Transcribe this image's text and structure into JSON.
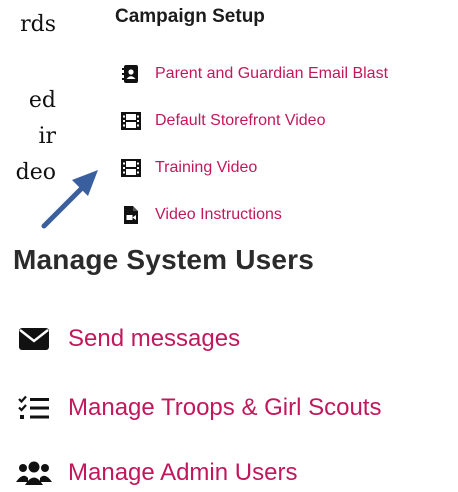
{
  "left_text": {
    "lines": [
      "rds",
      "ed",
      "ir",
      "deo"
    ]
  },
  "campaign_setup": {
    "title": "Campaign Setup",
    "items": [
      {
        "label": "Parent and Guardian Email Blast",
        "icon": "address-book-icon"
      },
      {
        "label": "Default Storefront Video",
        "icon": "film-icon"
      },
      {
        "label": "Training Video",
        "icon": "film-icon"
      },
      {
        "label": "Video Instructions",
        "icon": "video-file-icon"
      }
    ]
  },
  "manage_system_users": {
    "title": "Manage System Users",
    "items": [
      {
        "label": "Send messages",
        "icon": "envelope-icon"
      },
      {
        "label": "Manage Troops & Girl Scouts",
        "icon": "checklist-icon"
      },
      {
        "label": "Manage Admin Users",
        "icon": "users-icon"
      }
    ]
  },
  "colors": {
    "link": "#c2185b",
    "heading": "#1c1c1c",
    "arrow": "#3a5f9e",
    "icon": "#111111"
  }
}
